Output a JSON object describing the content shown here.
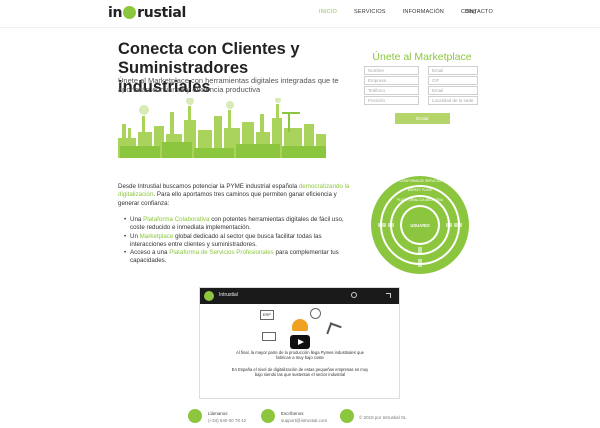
{
  "header": {
    "logo_text_left": "in",
    "logo_text_right": "rustial",
    "nav": [
      {
        "label": "INICIO",
        "active": true
      },
      {
        "label": "SERVICIOS",
        "active": false
      },
      {
        "label": "INFORMACIÓN",
        "active": false
      },
      {
        "label": "CONTACTO",
        "active": false
      }
    ],
    "blog": "Blog"
  },
  "hero": {
    "title": "Conecta con Clientes y Suministradores industriales",
    "subtitle": "Únete al Marketplace con herramientas digitales integradas que te aportarán confianza y eficiencia productiva"
  },
  "form": {
    "title": "Únete al Marketplace",
    "fields": [
      "Nombre",
      "Email",
      "Empresa",
      "CIF",
      "Teléfono",
      "Email",
      "Posición",
      "Localidad de la sede"
    ],
    "submit": "Enviar"
  },
  "intro": {
    "text_a": "Desde Intrustial buscamos potenciar la PYME industrial española ",
    "text_hl": "democratizando la digitalización",
    "text_b": ". Para ello aportamos tres caminos que permiten ganar eficiencia y generar confianza:"
  },
  "bullets": [
    {
      "a": "Una ",
      "hl": "Plataforma Colaborativa",
      "b": " con potentes herramientas digitales de fácil uso, coste reducido e inmediata implementación."
    },
    {
      "a": "Un ",
      "hl": "Marketplace",
      "b": " global dedicado al sector que busca facilitar todas las interacciones entre clientes y suministradores."
    },
    {
      "a": "Acceso a una ",
      "hl": "Plataforma de Servicios Profesionales",
      "b": " para complementar tus capacidades."
    }
  ],
  "diagram": {
    "outer": "PLATAFORMA DE SERVICIOS",
    "middle": "MARKET PLACE",
    "inner": "PLATAFORMA COLABORATIVA",
    "center": "USUARIO"
  },
  "video": {
    "title": "Intrustial",
    "erp": "ERP",
    "caption1": "Al final, la mayor parte de la producción llega Pymes industriales que fabrican a muy bajo coste",
    "caption2": "En España el nivel de digitalización de estas pequeñas empresas es muy bajo siendo las que sustentan el sector industrial"
  },
  "footer": {
    "phone_label": "Llámanos",
    "phone_value": "(+34) 640 00 78 42",
    "email_label": "Escríbenos",
    "email_value": "support@intrustial.com",
    "copy": "© 2019 por Intrustial SL"
  },
  "colors": {
    "accent": "#8cc63f",
    "accent_light": "#b5d56a",
    "text": "#222222"
  }
}
